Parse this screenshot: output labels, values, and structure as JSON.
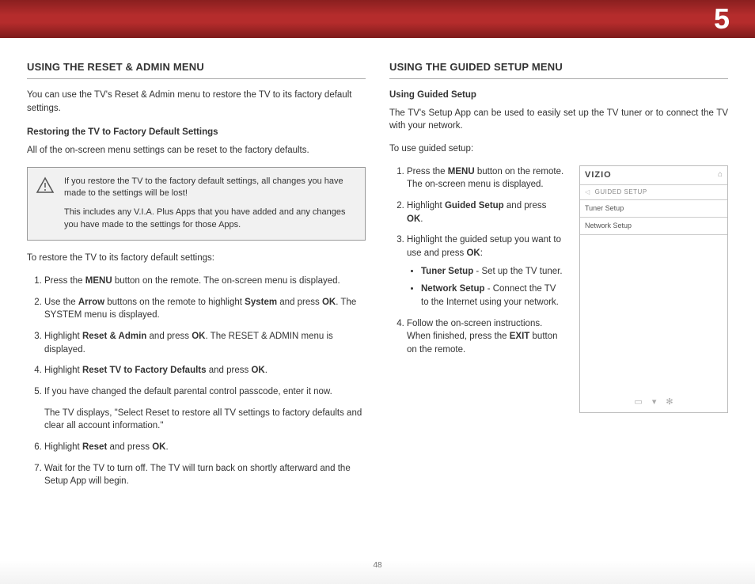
{
  "chapterNumber": "5",
  "pageNumber": "48",
  "left": {
    "heading": "USING THE RESET & ADMIN MENU",
    "intro": "You can use the TV's Reset & Admin menu to restore the TV to its factory default settings.",
    "subhead": "Restoring the TV to Factory Default Settings",
    "subpara": "All of the on-screen menu settings can be reset to the factory defaults.",
    "callout1": "If you restore the TV to the factory default settings, all changes you have made to the settings will be lost!",
    "callout2": "This includes any V.I.A. Plus Apps that you have added and any changes you have made to the settings for those Apps.",
    "restoreLead": "To restore the TV to its factory default settings:",
    "s1a": "Press the ",
    "s1b": "MENU",
    "s1c": " button on the remote. The on-screen menu is displayed.",
    "s2a": "Use the ",
    "s2b": "Arrow",
    "s2c": " buttons on the remote to highlight ",
    "s2d": "System",
    "s2e": " and press ",
    "s2f": "OK",
    "s2g": ". The SYSTEM menu is displayed.",
    "s3a": "Highlight ",
    "s3b": "Reset & Admin",
    "s3c": " and press ",
    "s3d": "OK",
    "s3e": ". The RESET & ADMIN menu is displayed.",
    "s4a": "Highlight ",
    "s4b": "Reset TV to Factory Defaults",
    "s4c": " and press ",
    "s4d": "OK",
    "s4e": ".",
    "s5a": "If you have changed the default parental control passcode, enter it now.",
    "s5b": "The TV displays, \"Select Reset to restore all TV settings to factory defaults and clear all account information.\"",
    "s6a": "Highlight ",
    "s6b": "Reset",
    "s6c": " and press ",
    "s6d": "OK",
    "s6e": ".",
    "s7": "Wait for the TV to turn off. The TV will turn back on shortly afterward and the Setup App will begin."
  },
  "right": {
    "heading": "USING THE GUIDED SETUP MENU",
    "subhead": "Using Guided Setup",
    "intro": "The TV's Setup App can be used to easily set up the TV tuner or to connect the TV with your network.",
    "lead": "To use guided setup:",
    "r1a": "Press the ",
    "r1b": "MENU",
    "r1c": " button on the remote. The on-screen menu is displayed.",
    "r2a": "Highlight ",
    "r2b": "Guided Setup",
    "r2c": " and press ",
    "r2d": "OK",
    "r2e": ".",
    "r3a": "Highlight the guided setup you want to use and press ",
    "r3b": "OK",
    "r3c": ":",
    "b1a": "Tuner Setup",
    "b1b": " - Set up the TV tuner.",
    "b2a": "Network Setup",
    "b2b": " - Connect the TV to the Internet using your network.",
    "r4a": "Follow the on-screen instructions. When finished, press the ",
    "r4b": "EXIT",
    "r4c": " button on the remote."
  },
  "menu": {
    "brand": "VIZIO",
    "title": "GUIDED SETUP",
    "item1": "Tuner Setup",
    "item2": "Network Setup"
  }
}
